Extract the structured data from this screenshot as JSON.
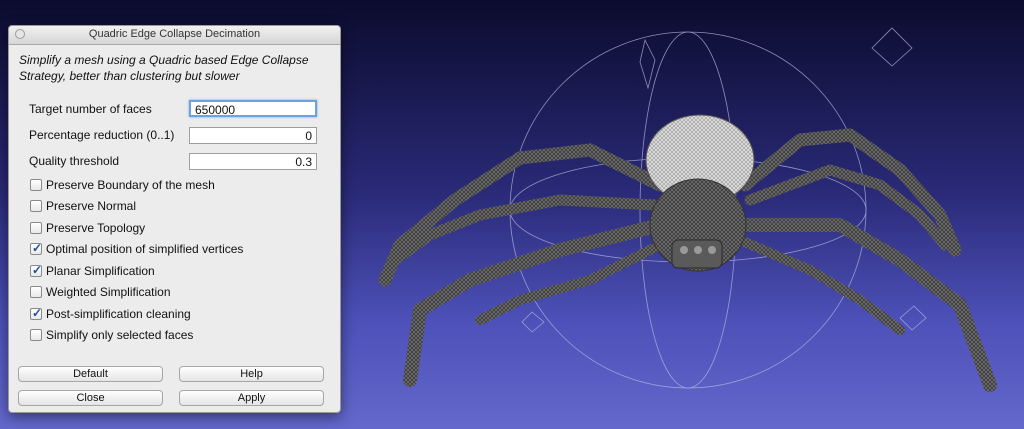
{
  "dialog": {
    "title": "Quadric Edge Collapse Decimation",
    "description": "Simplify a mesh using a Quadric based Edge Collapse Strategy, better than clustering but slower",
    "fields": [
      {
        "label": "Target number of faces",
        "value": "650000"
      },
      {
        "label": "Percentage reduction (0..1)",
        "value": "0"
      },
      {
        "label": "Quality threshold",
        "value": "0.3"
      }
    ],
    "checkboxes": [
      {
        "label": "Preserve Boundary of the mesh",
        "checked": false
      },
      {
        "label": "Preserve Normal",
        "checked": false
      },
      {
        "label": "Preserve Topology",
        "checked": false
      },
      {
        "label": "Optimal position of simplified vertices",
        "checked": true
      },
      {
        "label": "Planar Simplification",
        "checked": true
      },
      {
        "label": "Weighted Simplification",
        "checked": false
      },
      {
        "label": "Post-simplification cleaning",
        "checked": true
      },
      {
        "label": "Simplify only selected faces",
        "checked": false
      }
    ],
    "buttons": {
      "default": "Default",
      "help": "Help",
      "close": "Close",
      "apply": "Apply"
    }
  },
  "viewport": {
    "model": "spider wireframe mesh",
    "background_top": "#0b0b2e",
    "background_bottom": "#6468cc"
  }
}
